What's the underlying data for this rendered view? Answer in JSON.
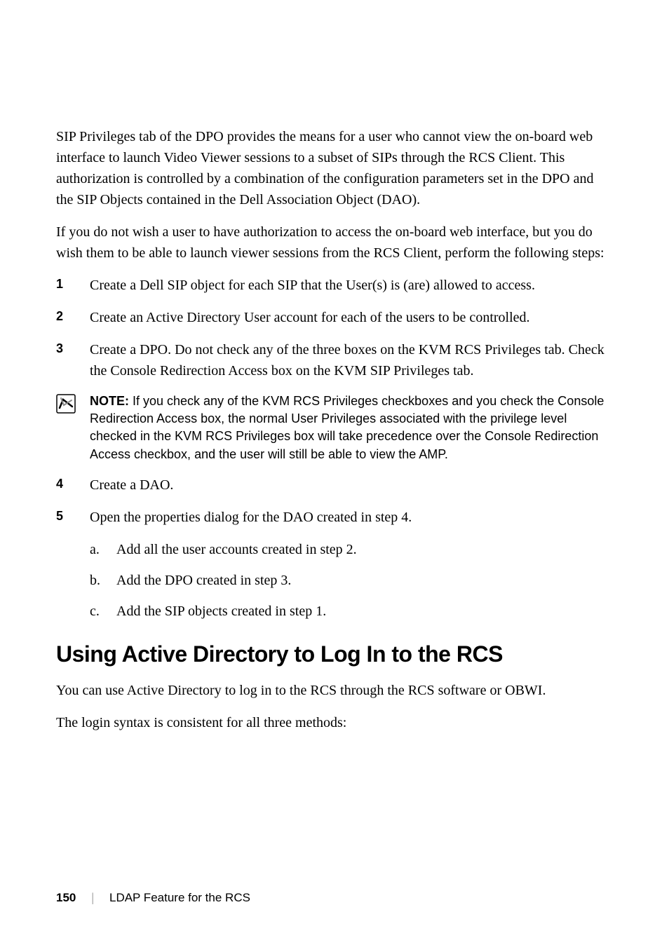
{
  "intro_paragraph_1": "SIP Privileges tab of the DPO provides the means for a user who cannot view the on-board web interface to launch Video Viewer sessions to a subset of SIPs through the RCS Client. This authorization is controlled by a combination of the configuration parameters set in the DPO and the SIP Objects contained in the Dell Association Object (DAO).",
  "intro_paragraph_2": "If you do not wish a user to have authorization to access the on-board web interface, but you do wish them to be able to launch viewer sessions from the RCS Client, perform the following steps:",
  "steps": {
    "1": {
      "num": "1",
      "text": "Create a Dell SIP object for each SIP that the User(s) is (are) allowed to access."
    },
    "2": {
      "num": "2",
      "text": "Create an Active Directory User account for each of the users to be controlled."
    },
    "3": {
      "num": "3",
      "text": "Create a DPO. Do not check any of the three boxes on the KVM RCS Privileges tab. Check the Console Redirection Access box on the KVM SIP Privileges tab."
    },
    "4": {
      "num": "4",
      "text": "Create a DAO."
    },
    "5": {
      "num": "5",
      "text": "Open the properties dialog for the DAO created in step 4."
    }
  },
  "note": {
    "label": "NOTE: ",
    "text": "If you check any of the KVM RCS Privileges checkboxes and you check the Console Redirection Access box, the normal User Privileges associated with the privilege level checked in the KVM RCS Privileges box will take precedence over the Console Redirection Access checkbox, and the user will still be able to view the AMP."
  },
  "substeps": {
    "a": {
      "letter": "a.",
      "text": "Add all the user accounts created in step 2."
    },
    "b": {
      "letter": "b.",
      "text": "Add the DPO created in step 3."
    },
    "c": {
      "letter": "c.",
      "text": "Add the SIP objects created in step 1."
    }
  },
  "section_heading": "Using Active Directory to Log In to the RCS",
  "section_para_1": "You can use Active Directory to log in to the RCS through the RCS software or OBWI.",
  "section_para_2": "The login syntax is consistent for all three methods:",
  "footer": {
    "page": "150",
    "title": "LDAP Feature for the RCS"
  }
}
